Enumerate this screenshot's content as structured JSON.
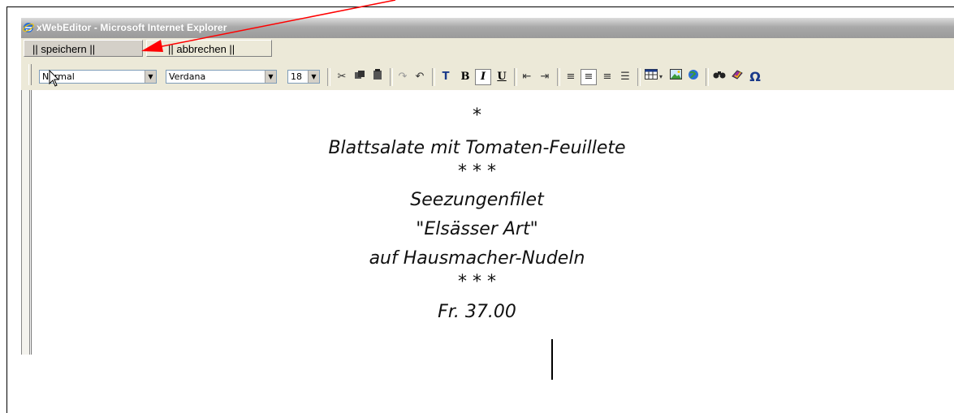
{
  "window": {
    "title": "xWebEditor - Microsoft Internet Explorer",
    "title_color": "#ffffff"
  },
  "tabs": {
    "save_label": "|| speichern ||",
    "cancel_label": "|| abbrechen ||"
  },
  "toolbar": {
    "style_select": "Normal",
    "font_select": "Verdana",
    "size_select": "18",
    "buttons": [
      "cut-icon",
      "copy-icon",
      "paste-icon",
      "redo-icon",
      "undo-icon",
      "text-color-icon",
      "bold-icon",
      "italic-icon",
      "underline-icon",
      "outdent-icon",
      "indent-icon",
      "align-left-icon",
      "align-center-icon",
      "align-right-icon",
      "bullet-list-icon",
      "table-icon",
      "image-icon",
      "web-link-icon",
      "find-icon",
      "spellcheck-icon",
      "special-char-icon"
    ],
    "bold": "B",
    "italic": "I",
    "underline": "U",
    "omega": "Ω",
    "text_color": "T"
  },
  "content": {
    "star1": "*",
    "line1": "Blattsalate mit Tomaten-Feuillete",
    "star2": "* * *",
    "line2": "Seezungenfilet",
    "line3": "\"Elsässer Art\"",
    "line4": "auf Hausmacher-Nudeln",
    "star3": "* * *",
    "price": "Fr. 37.00"
  },
  "annotation": {
    "arrow_color": "#ff0000"
  }
}
